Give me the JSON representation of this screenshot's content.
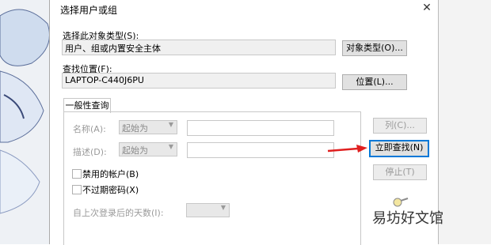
{
  "dialog": {
    "title": "选择用户或组",
    "close_glyph": "✕"
  },
  "object_types": {
    "label": "选择此对象类型(S):",
    "value": "用户、组或内置安全主体",
    "button": "对象类型(O)..."
  },
  "location": {
    "label": "查找位置(F):",
    "value": "LAPTOP-C440J6PU",
    "button": "位置(L)..."
  },
  "query_tab": {
    "label": "一般性查询",
    "name_label": "名称(A):",
    "name_mode": "起始为",
    "desc_label": "描述(D):",
    "desc_mode": "起始为",
    "disabled_accounts": "禁用的帐户(B)",
    "non_expiring_pwd": "不过期密码(X)",
    "days_since_login": "自上次登录后的天数(I):"
  },
  "side_buttons": {
    "columns": "列(C)...",
    "find_now": "立即查找(N)",
    "stop": "停止(T)"
  },
  "watermark": "易坊好文馆",
  "colors": {
    "arrow": "#e02020",
    "focus": "#0078d7"
  }
}
